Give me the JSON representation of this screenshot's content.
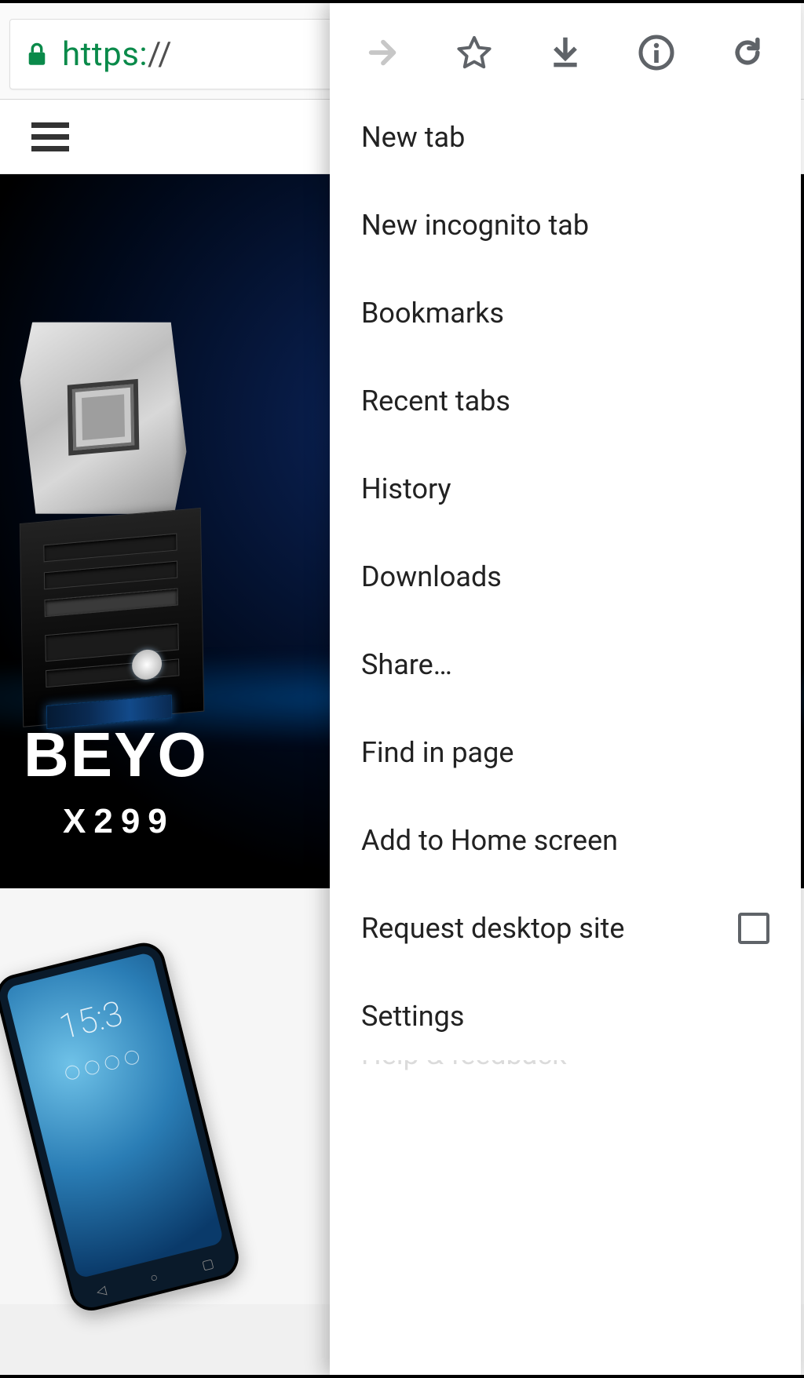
{
  "url_bar": {
    "protocol": "https:",
    "rest": "//"
  },
  "hero": {
    "title_partial": "BEYO",
    "sub_partial": "X299 "
  },
  "phone": {
    "time_partial": "15:3"
  },
  "menu": {
    "items": [
      "New tab",
      "New incognito tab",
      "Bookmarks",
      "Recent tabs",
      "History",
      "Downloads",
      "Share…",
      "Find in page",
      "Add to Home screen",
      "Request desktop site",
      "Settings",
      "Help & feedback"
    ]
  }
}
